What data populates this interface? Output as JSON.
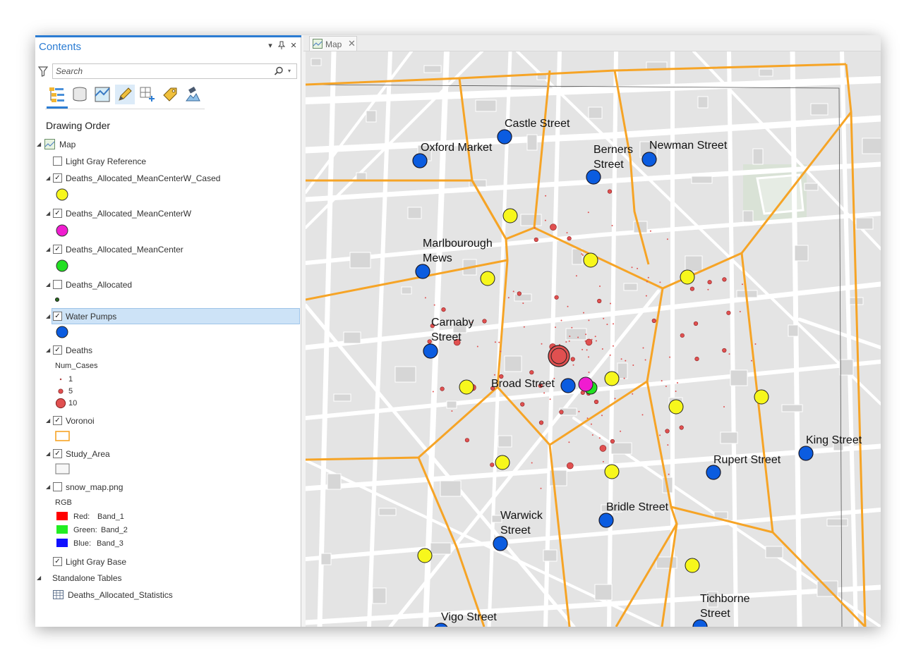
{
  "contents": {
    "title": "Contents",
    "pane_buttons": [
      "▾",
      "⊣",
      "✕"
    ],
    "search": {
      "placeholder": "Search",
      "value": ""
    },
    "toolbar_icons": [
      "list-by-drawing-order-icon",
      "list-by-data-source-icon",
      "list-by-selection-icon",
      "list-by-editing-icon",
      "list-by-snapping-icon",
      "list-by-labeling-icon",
      "list-by-perspective-imagery-icon"
    ],
    "section_label": "Drawing Order",
    "map_label": "Map",
    "layers": [
      {
        "name": "Light Gray Reference",
        "checked": false
      },
      {
        "name": "Deaths_Allocated_MeanCenterW_Cased",
        "checked": true
      },
      {
        "name": "Deaths_Allocated_MeanCenterW",
        "checked": true
      },
      {
        "name": "Deaths_Allocated_MeanCenter",
        "checked": true
      },
      {
        "name": "Deaths_Allocated",
        "checked": false
      },
      {
        "name": "Water Pumps",
        "checked": true,
        "selected": true
      },
      {
        "name": "Deaths",
        "checked": true
      },
      {
        "name": "Voronoi",
        "checked": true
      },
      {
        "name": "Study_Area",
        "checked": true
      },
      {
        "name": "snow_map.png",
        "checked": false
      },
      {
        "name": "Light Gray Base",
        "checked": true
      }
    ],
    "deaths_legend": {
      "field": "Num_Cases",
      "classes": [
        "1",
        "5",
        "10"
      ]
    },
    "rgb_legend": {
      "title": "RGB",
      "bands": [
        {
          "channel": "Red:",
          "band": "Band_1",
          "color": "#ff0000"
        },
        {
          "channel": "Green:",
          "band": "Band_2",
          "color": "#22ee22"
        },
        {
          "channel": "Blue:",
          "band": "Band_3",
          "color": "#1010ff"
        }
      ]
    },
    "standalone_tables": {
      "label": "Standalone Tables",
      "items": [
        "Deaths_Allocated_Statistics"
      ]
    }
  },
  "map": {
    "tab_label": "Map",
    "tab_close": "✕",
    "colors": {
      "pump": "#0b5ce0",
      "mean_center_weighted_cased": "#f7f71c",
      "mean_center_weighted": "#f01cd0",
      "mean_center": "#22e022",
      "deaths": "#e05050",
      "voronoi": "#f6a426",
      "background": "#e4e4e4",
      "road": "#ffffff"
    },
    "pumps": [
      {
        "label": "Castle Street"
      },
      {
        "label": "Oxford Market"
      },
      {
        "label": "Berners Street"
      },
      {
        "label": "Newman Street"
      },
      {
        "label": "Marlbourough Mews"
      },
      {
        "label": "Carnaby Street"
      },
      {
        "label": "Broad Street"
      },
      {
        "label": "King Street"
      },
      {
        "label": "Rupert Street"
      },
      {
        "label": "Warwick Street"
      },
      {
        "label": "Bridle Street"
      },
      {
        "label": "Tichborne Street"
      },
      {
        "label": "Vigo Street"
      }
    ]
  }
}
